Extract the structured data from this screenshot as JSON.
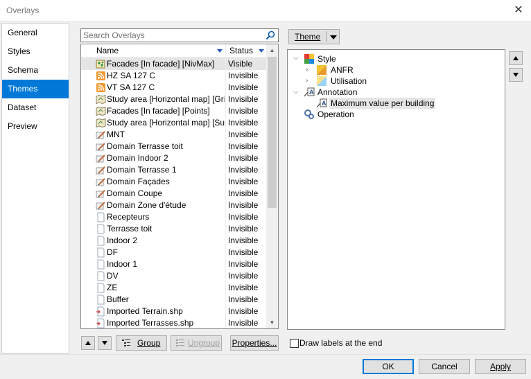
{
  "window": {
    "title": "Overlays"
  },
  "nav": {
    "items": [
      {
        "label": "General"
      },
      {
        "label": "Styles"
      },
      {
        "label": "Schema"
      },
      {
        "label": "Themes",
        "selected": true
      },
      {
        "label": "Dataset"
      },
      {
        "label": "Preview"
      }
    ]
  },
  "search": {
    "placeholder": "Search Overlays"
  },
  "overlay_list": {
    "columns": {
      "name": "Name",
      "status": "Status"
    },
    "rows": [
      {
        "name": "Facades [In facade] [NivMax]",
        "status": "Visible",
        "icon": "map-points-icon",
        "selected": true
      },
      {
        "name": "HZ SA 127 C",
        "status": "Invisible",
        "icon": "rss-feed-icon"
      },
      {
        "name": "VT SA 127 C",
        "status": "Invisible",
        "icon": "rss-feed-icon"
      },
      {
        "name": "Study area [Horizontal map] [Grille]",
        "status": "Invisible",
        "icon": "map-icon"
      },
      {
        "name": "Facades [In facade] [Points]",
        "status": "Invisible",
        "icon": "map-icon"
      },
      {
        "name": "Study area [Horizontal map] [Surf...",
        "status": "Invisible",
        "icon": "map-icon"
      },
      {
        "name": "MNT",
        "status": "Invisible",
        "icon": "pencil-layer-icon"
      },
      {
        "name": "Domain Terrasse toit",
        "status": "Invisible",
        "icon": "pencil-layer-icon"
      },
      {
        "name": "Domain Indoor 2",
        "status": "Invisible",
        "icon": "pencil-layer-icon"
      },
      {
        "name": "Domain Terrasse 1",
        "status": "Invisible",
        "icon": "pencil-layer-icon"
      },
      {
        "name": "Domain Façades",
        "status": "Invisible",
        "icon": "pencil-layer-icon"
      },
      {
        "name": "Domain Coupe",
        "status": "Invisible",
        "icon": "pencil-layer-icon"
      },
      {
        "name": "Domain Zone d'étude",
        "status": "Invisible",
        "icon": "pencil-layer-icon"
      },
      {
        "name": "Recepteurs",
        "status": "Invisible",
        "icon": "blank-page-icon"
      },
      {
        "name": "Terrasse toit",
        "status": "Invisible",
        "icon": "blank-page-icon"
      },
      {
        "name": "Indoor 2",
        "status": "Invisible",
        "icon": "blank-page-icon"
      },
      {
        "name": "DF",
        "status": "Invisible",
        "icon": "blank-page-icon"
      },
      {
        "name": "Indoor 1",
        "status": "Invisible",
        "icon": "blank-page-icon"
      },
      {
        "name": "DV",
        "status": "Invisible",
        "icon": "blank-page-icon"
      },
      {
        "name": "ZE",
        "status": "Invisible",
        "icon": "blank-page-icon"
      },
      {
        "name": "Buffer",
        "status": "Invisible",
        "icon": "blank-page-icon"
      },
      {
        "name": "Imported Terrain.shp",
        "status": "Invisible",
        "icon": "shapefile-icon"
      },
      {
        "name": "Imported Terrasses.shp",
        "status": "Invisible",
        "icon": "shapefile-icon"
      }
    ]
  },
  "list_buttons": {
    "group": "Group",
    "ungroup": "Ungroup",
    "properties": "Properties..."
  },
  "theme": {
    "button_label": "Theme",
    "tree": {
      "style": "Style",
      "anfr": "ANFR",
      "utilisation": "Utilisation",
      "annotation": "Annotation",
      "max_value": "Maximum value per building",
      "operation": "Operation"
    }
  },
  "draw_labels": {
    "label": "Draw labels at the end",
    "checked": false
  },
  "footer": {
    "ok": "OK",
    "cancel": "Cancel",
    "apply": "Apply"
  },
  "colors": {
    "selection": "#0078d7",
    "default_border": "#0078d7"
  }
}
